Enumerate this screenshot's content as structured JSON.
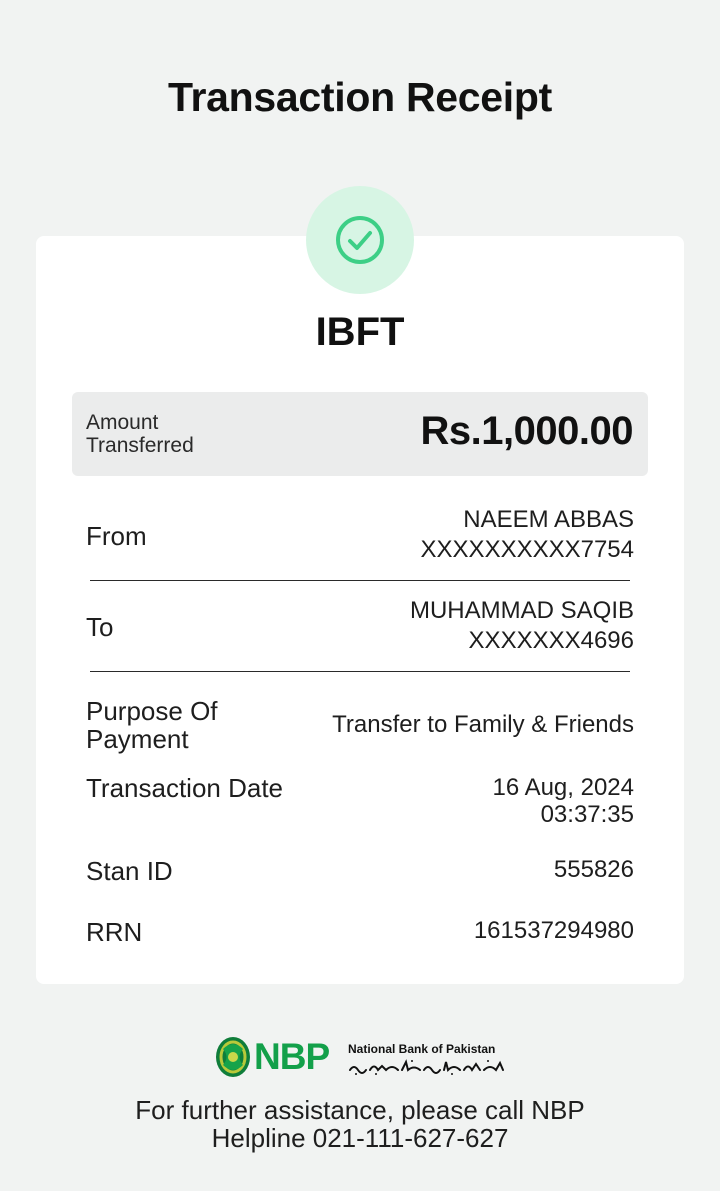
{
  "header": {
    "title": "Transaction Receipt"
  },
  "receipt": {
    "status_icon": "check-circle-icon",
    "transaction_type": "IBFT",
    "amount": {
      "label": "Amount Transferred",
      "value": "Rs.1,000.00"
    },
    "from": {
      "label": "From",
      "name": "NAEEM ABBAS",
      "account": "XXXXXXXXXX7754"
    },
    "to": {
      "label": "To",
      "name": "MUHAMMAD SAQIB",
      "account": "XXXXXXX4696"
    },
    "purpose": {
      "label": "Purpose Of Payment",
      "value": "Transfer to Family & Friends"
    },
    "transaction_date": {
      "label": "Transaction Date",
      "date": "16 Aug, 2024",
      "time": "03:37:35"
    },
    "stan_id": {
      "label": "Stan ID",
      "value": "555826"
    },
    "rrn": {
      "label": "RRN",
      "value": "161537294980"
    }
  },
  "footer": {
    "logo": {
      "abbreviation": "NBP",
      "name": "National Bank of Pakistan",
      "name_urdu": "نیشنل بینک آف پاکستان"
    },
    "help_text": "For further assistance, please call NBP Helpline 021-111-627-627"
  },
  "colors": {
    "background": "#f1f3f2",
    "card": "#ffffff",
    "success_badge_bg": "#d7f5e4",
    "success_icon": "#3dcf86",
    "brand_green": "#13a04a",
    "amount_box_bg": "#ebecec"
  }
}
